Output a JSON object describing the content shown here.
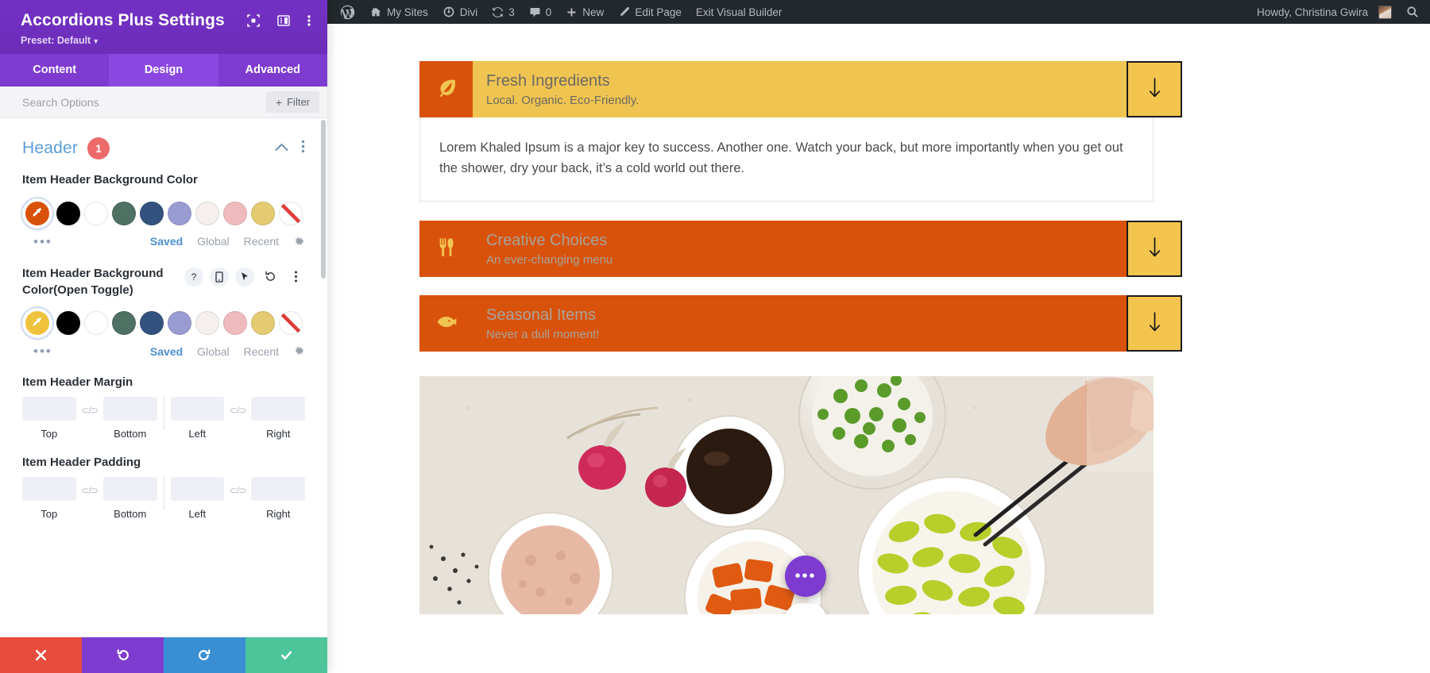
{
  "panel": {
    "title": "Accordions Plus Settings",
    "preset": "Preset: Default",
    "head_icons": [
      {
        "name": "focus-icon"
      },
      {
        "name": "layout-columns-icon"
      },
      {
        "name": "more-vertical-icon"
      }
    ],
    "tabs": [
      {
        "label": "Content",
        "active": false
      },
      {
        "label": "Design",
        "active": true
      },
      {
        "label": "Advanced",
        "active": false
      }
    ],
    "search": {
      "placeholder": "Search Options",
      "value": ""
    },
    "filter_label": "Filter",
    "section": {
      "title": "Header",
      "badge": "1"
    },
    "color_fields": [
      {
        "label": "Item Header Background Color",
        "selected_color": "#d9520b",
        "swatches": [
          "#000000",
          "#ffffff",
          "#4f7164",
          "#33527f",
          "#9b9bd4",
          "#f5f0ee",
          "#f0bbbe",
          "#e4cb72",
          "none"
        ],
        "links": [
          {
            "label": "Saved",
            "active": true
          },
          {
            "label": "Global",
            "active": false
          },
          {
            "label": "Recent",
            "active": false
          }
        ],
        "has_icon_row": false
      },
      {
        "label": "Item Header Background Color(Open Toggle)",
        "selected_color": "#eec23c",
        "swatches": [
          "#000000",
          "#ffffff",
          "#4f7164",
          "#33527f",
          "#9b9bd4",
          "#f5f0ee",
          "#f0bbbe",
          "#e4cb72",
          "none"
        ],
        "links": [
          {
            "label": "Saved",
            "active": true
          },
          {
            "label": "Global",
            "active": false
          },
          {
            "label": "Recent",
            "active": false
          }
        ],
        "has_icon_row": true,
        "icon_row": [
          "help-icon",
          "mobile-icon",
          "cursor-icon",
          "reset-icon",
          "more-vertical-icon"
        ]
      }
    ],
    "spacing_fields": [
      {
        "label": "Item Header Margin",
        "inputs": [
          {
            "caption": "Top",
            "value": ""
          },
          {
            "caption": "Bottom",
            "value": ""
          },
          {
            "caption": "Left",
            "value": ""
          },
          {
            "caption": "Right",
            "value": ""
          }
        ]
      },
      {
        "label": "Item Header Padding",
        "inputs": [
          {
            "caption": "Top",
            "value": ""
          },
          {
            "caption": "Bottom",
            "value": ""
          },
          {
            "caption": "Left",
            "value": ""
          },
          {
            "caption": "Right",
            "value": ""
          }
        ]
      }
    ],
    "footer_buttons": [
      {
        "name": "cancel-button",
        "icon": "close-icon",
        "color": "#e74c3c"
      },
      {
        "name": "undo-button",
        "icon": "undo-icon",
        "color": "#7e3bd0"
      },
      {
        "name": "redo-button",
        "icon": "redo-icon",
        "color": "#3a8fd4"
      },
      {
        "name": "save-button",
        "icon": "check-icon",
        "color": "#4dc49a"
      }
    ]
  },
  "adminbar": {
    "items": [
      {
        "name": "wordpress-logo-icon",
        "label": "",
        "icon": "wordpress"
      },
      {
        "name": "my-sites-menu",
        "label": "My Sites",
        "icon": "sites"
      },
      {
        "name": "divi-menu",
        "label": "Divi",
        "icon": "divi"
      },
      {
        "name": "updates-menu",
        "label": "3",
        "icon": "updates"
      },
      {
        "name": "comments-menu",
        "label": "0",
        "icon": "comments"
      },
      {
        "name": "new-menu",
        "label": "New",
        "icon": "plus"
      },
      {
        "name": "edit-page-menu",
        "label": "Edit Page",
        "icon": "pencil"
      },
      {
        "name": "exit-visual-builder",
        "label": "Exit Visual Builder",
        "icon": ""
      }
    ],
    "howdy": "Howdy, Christina Gwira",
    "search_icon": "search-icon"
  },
  "content": {
    "accordions": [
      {
        "title": "Fresh Ingredients",
        "subtitle": "Local. Organic. Eco-Friendly.",
        "icon": "leaf-icon",
        "header_bg": "#f0c451",
        "icon_bg": "#d9520b",
        "icon_color": "#f0c451",
        "title_color": "#6b6a62",
        "sub_color": "#6b6a62",
        "open": true,
        "body": "Lorem Khaled Ipsum is a major key to success. Another one. Watch your back, but more importantly when you get out the shower, dry your back, it’s a cold world out there."
      },
      {
        "title": "Creative Choices",
        "subtitle": "An ever-changing menu",
        "icon": "utensils-icon",
        "header_bg": "#d9520b",
        "icon_bg": "#d9520b",
        "icon_color": "#f0c451",
        "title_color": "#a8a39a",
        "sub_color": "#a8a39a",
        "open": false,
        "body": ""
      },
      {
        "title": "Seasonal Items",
        "subtitle": "Never a dull moment!",
        "icon": "fish-icon",
        "header_bg": "#d9520b",
        "icon_bg": "#d9520b",
        "icon_color": "#f0c451",
        "title_color": "#a8a39a",
        "sub_color": "#a8a39a",
        "open": false,
        "body": ""
      }
    ],
    "toggle_button": {
      "bg": "#f3c54e",
      "border": "#1b1b1b",
      "icon": "arrow-down-icon"
    },
    "fab": {
      "name": "module-options-fab",
      "icon": "ellipsis-icon",
      "label": "•••"
    }
  }
}
